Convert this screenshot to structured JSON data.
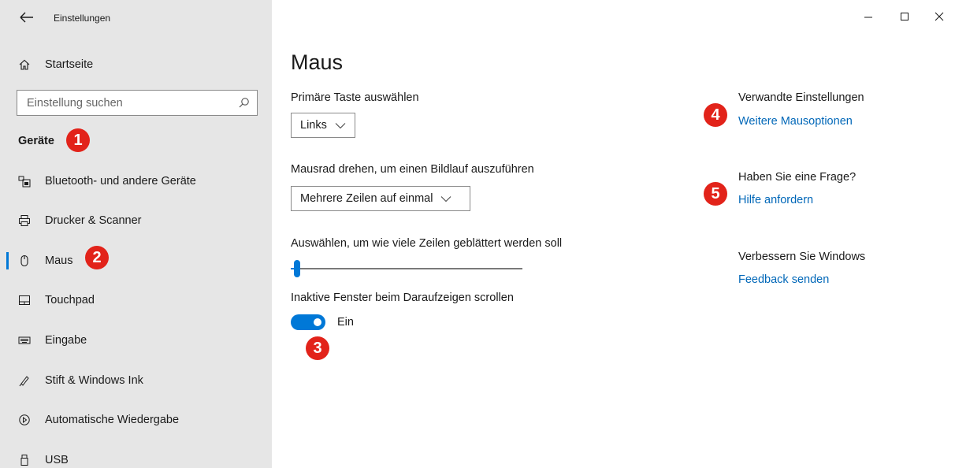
{
  "window": {
    "title": "Einstellungen",
    "controls": [
      "minimize",
      "maximize",
      "close"
    ]
  },
  "sidebar": {
    "home_label": "Startseite",
    "search": {
      "placeholder": "Einstellung suchen",
      "value": ""
    },
    "section_heading": "Geräte",
    "items": [
      {
        "label": "Bluetooth- und andere Geräte",
        "icon": "bluetooth-devices-icon"
      },
      {
        "label": "Drucker & Scanner",
        "icon": "printer-icon"
      },
      {
        "label": "Maus",
        "icon": "mouse-icon",
        "active": true
      },
      {
        "label": "Touchpad",
        "icon": "touchpad-icon"
      },
      {
        "label": "Eingabe",
        "icon": "keyboard-icon"
      },
      {
        "label": "Stift & Windows Ink",
        "icon": "pen-icon"
      },
      {
        "label": "Automatische Wiedergabe",
        "icon": "autoplay-icon"
      },
      {
        "label": "USB",
        "icon": "usb-icon"
      }
    ]
  },
  "main": {
    "title": "Maus",
    "primary_button": {
      "label": "Primäre Taste auswählen",
      "value": "Links"
    },
    "scroll_wheel": {
      "label": "Mausrad drehen, um einen Bildlauf auszuführen",
      "value": "Mehrere Zeilen auf einmal"
    },
    "lines_slider": {
      "label": "Auswählen, um wie viele Zeilen geblättert werden soll",
      "level_fraction": 0.02
    },
    "inactive_scroll": {
      "label": "Inaktive Fenster beim Daraufzeigen scrollen",
      "state": "Ein",
      "on": true
    }
  },
  "related": {
    "heading": "Verwandte Einstellungen",
    "link": "Weitere Mausoptionen",
    "question_heading": "Haben Sie eine Frage?",
    "help_link": "Hilfe anfordern",
    "improve_heading": "Verbessern Sie Windows",
    "feedback_link": "Feedback senden"
  },
  "annotations": [
    "1",
    "2",
    "3",
    "4",
    "5"
  ],
  "colors": {
    "accent": "#0078d7",
    "link": "#0067b8",
    "badge": "#e2231a",
    "sidebar_bg": "#e6e6e6"
  }
}
